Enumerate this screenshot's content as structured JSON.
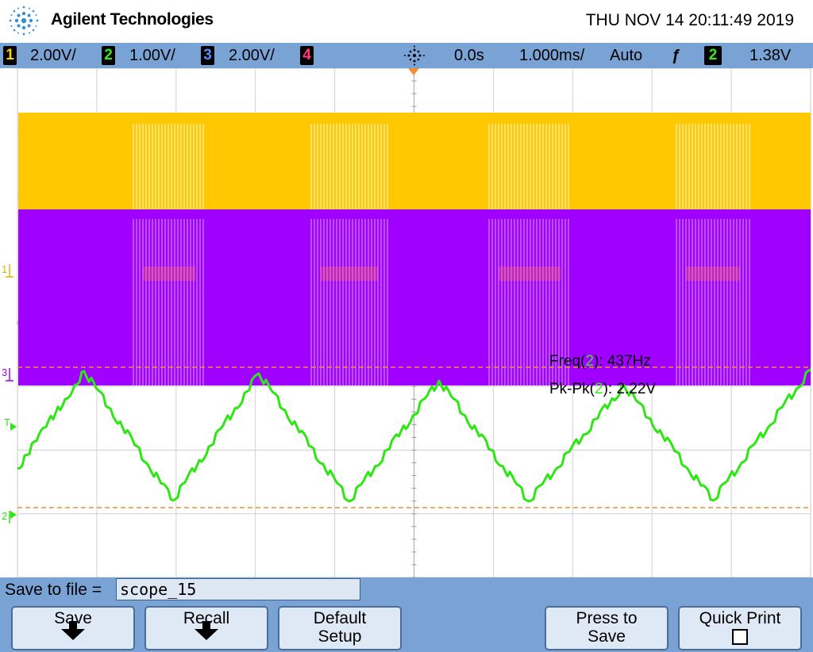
{
  "header": {
    "brand": "Agilent Technologies",
    "datetime": "THU NOV 14 20:11:49 2019"
  },
  "status_bar": {
    "ch1_num": "1",
    "ch1_scale": "2.00V/",
    "ch1_color": "#ffd200",
    "ch2_num": "2",
    "ch2_scale": "1.00V/",
    "ch2_color": "#3ce61e",
    "ch3_num": "3",
    "ch3_scale": "2.00V/",
    "ch3_color": "#5a8cff",
    "ch4_num": "4",
    "ch4_color": "#ff3c78",
    "delay": "0.0s",
    "timebase": "1.000ms/",
    "mode": "Auto",
    "trigger_slope": "ƒ",
    "trigger_ch": "2",
    "trigger_level": "1.38V"
  },
  "markers": {
    "ch1": "1",
    "ch3": "3",
    "trigger": "T",
    "ch2": "2"
  },
  "measurements": {
    "freq_prefix": "Freq(",
    "freq_ch": "2",
    "freq_suffix": "): 437Hz",
    "pkpk_prefix": "Pk-Pk(",
    "pkpk_ch": "2",
    "pkpk_suffix": "): 2.22V"
  },
  "file": {
    "label": "Save to file =",
    "value": "scope_15"
  },
  "softkeys": {
    "save": "Save",
    "recall": "Recall",
    "default_line1": "Default",
    "default_line2": "Setup",
    "press_line1": "Press to",
    "press_line2": "Save",
    "quick_print": "Quick Print"
  },
  "colors": {
    "ch1_trace": "#ffc800",
    "ch3_trace": "#a000ff",
    "ch2_trace": "#2ee614",
    "reference_line": "#f08c32",
    "grid": "#b4b4b4",
    "ui_blue": "#7aa3d5"
  },
  "waveform": {
    "ch2_freq_hz": 437,
    "ch2_pk_pk_v": 2.22,
    "ch2_shape": "triangle with ripple"
  }
}
